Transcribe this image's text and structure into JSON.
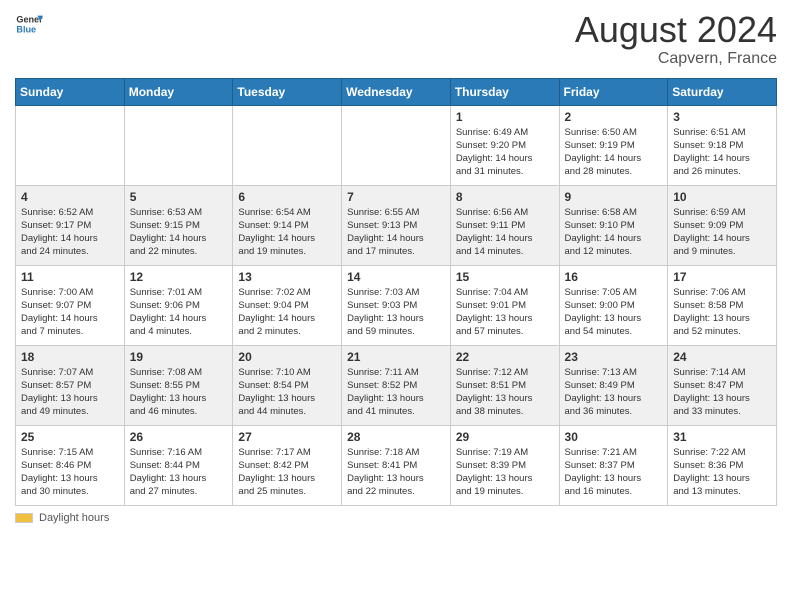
{
  "header": {
    "logo_general": "General",
    "logo_blue": "Blue",
    "month_year": "August 2024",
    "location": "Capvern, France"
  },
  "days_of_week": [
    "Sunday",
    "Monday",
    "Tuesday",
    "Wednesday",
    "Thursday",
    "Friday",
    "Saturday"
  ],
  "weeks": [
    [
      {
        "day": "",
        "info": ""
      },
      {
        "day": "",
        "info": ""
      },
      {
        "day": "",
        "info": ""
      },
      {
        "day": "",
        "info": ""
      },
      {
        "day": "1",
        "info": "Sunrise: 6:49 AM\nSunset: 9:20 PM\nDaylight: 14 hours\nand 31 minutes."
      },
      {
        "day": "2",
        "info": "Sunrise: 6:50 AM\nSunset: 9:19 PM\nDaylight: 14 hours\nand 28 minutes."
      },
      {
        "day": "3",
        "info": "Sunrise: 6:51 AM\nSunset: 9:18 PM\nDaylight: 14 hours\nand 26 minutes."
      }
    ],
    [
      {
        "day": "4",
        "info": "Sunrise: 6:52 AM\nSunset: 9:17 PM\nDaylight: 14 hours\nand 24 minutes."
      },
      {
        "day": "5",
        "info": "Sunrise: 6:53 AM\nSunset: 9:15 PM\nDaylight: 14 hours\nand 22 minutes."
      },
      {
        "day": "6",
        "info": "Sunrise: 6:54 AM\nSunset: 9:14 PM\nDaylight: 14 hours\nand 19 minutes."
      },
      {
        "day": "7",
        "info": "Sunrise: 6:55 AM\nSunset: 9:13 PM\nDaylight: 14 hours\nand 17 minutes."
      },
      {
        "day": "8",
        "info": "Sunrise: 6:56 AM\nSunset: 9:11 PM\nDaylight: 14 hours\nand 14 minutes."
      },
      {
        "day": "9",
        "info": "Sunrise: 6:58 AM\nSunset: 9:10 PM\nDaylight: 14 hours\nand 12 minutes."
      },
      {
        "day": "10",
        "info": "Sunrise: 6:59 AM\nSunset: 9:09 PM\nDaylight: 14 hours\nand 9 minutes."
      }
    ],
    [
      {
        "day": "11",
        "info": "Sunrise: 7:00 AM\nSunset: 9:07 PM\nDaylight: 14 hours\nand 7 minutes."
      },
      {
        "day": "12",
        "info": "Sunrise: 7:01 AM\nSunset: 9:06 PM\nDaylight: 14 hours\nand 4 minutes."
      },
      {
        "day": "13",
        "info": "Sunrise: 7:02 AM\nSunset: 9:04 PM\nDaylight: 14 hours\nand 2 minutes."
      },
      {
        "day": "14",
        "info": "Sunrise: 7:03 AM\nSunset: 9:03 PM\nDaylight: 13 hours\nand 59 minutes."
      },
      {
        "day": "15",
        "info": "Sunrise: 7:04 AM\nSunset: 9:01 PM\nDaylight: 13 hours\nand 57 minutes."
      },
      {
        "day": "16",
        "info": "Sunrise: 7:05 AM\nSunset: 9:00 PM\nDaylight: 13 hours\nand 54 minutes."
      },
      {
        "day": "17",
        "info": "Sunrise: 7:06 AM\nSunset: 8:58 PM\nDaylight: 13 hours\nand 52 minutes."
      }
    ],
    [
      {
        "day": "18",
        "info": "Sunrise: 7:07 AM\nSunset: 8:57 PM\nDaylight: 13 hours\nand 49 minutes."
      },
      {
        "day": "19",
        "info": "Sunrise: 7:08 AM\nSunset: 8:55 PM\nDaylight: 13 hours\nand 46 minutes."
      },
      {
        "day": "20",
        "info": "Sunrise: 7:10 AM\nSunset: 8:54 PM\nDaylight: 13 hours\nand 44 minutes."
      },
      {
        "day": "21",
        "info": "Sunrise: 7:11 AM\nSunset: 8:52 PM\nDaylight: 13 hours\nand 41 minutes."
      },
      {
        "day": "22",
        "info": "Sunrise: 7:12 AM\nSunset: 8:51 PM\nDaylight: 13 hours\nand 38 minutes."
      },
      {
        "day": "23",
        "info": "Sunrise: 7:13 AM\nSunset: 8:49 PM\nDaylight: 13 hours\nand 36 minutes."
      },
      {
        "day": "24",
        "info": "Sunrise: 7:14 AM\nSunset: 8:47 PM\nDaylight: 13 hours\nand 33 minutes."
      }
    ],
    [
      {
        "day": "25",
        "info": "Sunrise: 7:15 AM\nSunset: 8:46 PM\nDaylight: 13 hours\nand 30 minutes."
      },
      {
        "day": "26",
        "info": "Sunrise: 7:16 AM\nSunset: 8:44 PM\nDaylight: 13 hours\nand 27 minutes."
      },
      {
        "day": "27",
        "info": "Sunrise: 7:17 AM\nSunset: 8:42 PM\nDaylight: 13 hours\nand 25 minutes."
      },
      {
        "day": "28",
        "info": "Sunrise: 7:18 AM\nSunset: 8:41 PM\nDaylight: 13 hours\nand 22 minutes."
      },
      {
        "day": "29",
        "info": "Sunrise: 7:19 AM\nSunset: 8:39 PM\nDaylight: 13 hours\nand 19 minutes."
      },
      {
        "day": "30",
        "info": "Sunrise: 7:21 AM\nSunset: 8:37 PM\nDaylight: 13 hours\nand 16 minutes."
      },
      {
        "day": "31",
        "info": "Sunrise: 7:22 AM\nSunset: 8:36 PM\nDaylight: 13 hours\nand 13 minutes."
      }
    ]
  ],
  "footer": {
    "daylight_label": "Daylight hours"
  }
}
